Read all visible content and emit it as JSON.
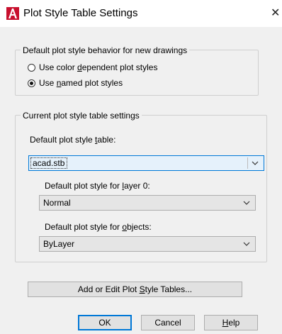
{
  "window": {
    "title": "Plot Style Table Settings",
    "app_icon": "autocad-a-icon",
    "close_glyph": "✕"
  },
  "default_behavior": {
    "legend": "Default plot style behavior for new drawings",
    "options": [
      {
        "label": "Use color dependent plot styles",
        "selected": false
      },
      {
        "label": "Use named plot styles",
        "selected": true
      }
    ]
  },
  "current_settings": {
    "legend": "Current plot style table settings",
    "table_label": "Default plot style table:",
    "table_value": "acad.stb",
    "layer0_label": "Default plot style for layer 0:",
    "layer0_value": "Normal",
    "objects_label": "Default plot style for objects:",
    "objects_value": "ByLayer"
  },
  "buttons": {
    "add_edit": "Add or Edit Plot Style Tables...",
    "ok": "OK",
    "cancel": "Cancel",
    "help": "Help"
  },
  "colors": {
    "app_red": "#c8102e",
    "focus_blue": "#0078d7"
  }
}
